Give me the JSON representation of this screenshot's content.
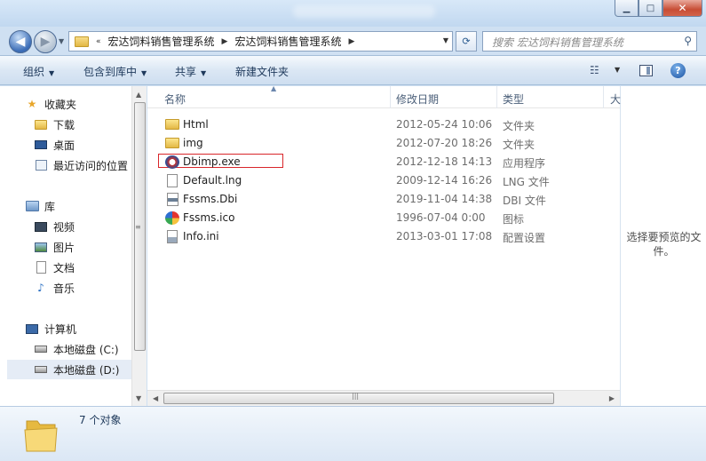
{
  "window": {
    "controls": {
      "minimize": "▁",
      "maximize": "□",
      "close": "✕"
    }
  },
  "address": {
    "overflow": "«",
    "segments": [
      "宏达饲料销售管理系统",
      "宏达饲料销售管理系统"
    ],
    "search_placeholder": "搜索 宏达饲料销售管理系统"
  },
  "toolbar": {
    "organize": "组织",
    "include_in_library": "包含到库中",
    "share": "共享",
    "new_folder": "新建文件夹"
  },
  "nav": {
    "favorites": "收藏夹",
    "downloads": "下载",
    "desktop": "桌面",
    "recent": "最近访问的位置",
    "libraries": "库",
    "videos": "视频",
    "pictures": "图片",
    "documents": "文档",
    "music": "音乐",
    "computer": "计算机",
    "drive_c": "本地磁盘 (C:)",
    "drive_d": "本地磁盘 (D:)"
  },
  "columns": {
    "name": "名称",
    "modified": "修改日期",
    "type": "类型",
    "size": "大"
  },
  "files": [
    {
      "name": "Html",
      "date": "2012-05-24 10:06",
      "type": "文件夹",
      "icon": "folder-icon"
    },
    {
      "name": "img",
      "date": "2012-07-20 18:26",
      "type": "文件夹",
      "icon": "folder-icon"
    },
    {
      "name": "Dbimp.exe",
      "date": "2012-12-18 14:13",
      "type": "应用程序",
      "icon": "app-icon"
    },
    {
      "name": "Default.lng",
      "date": "2009-12-14 16:26",
      "type": "LNG 文件",
      "icon": "file-icon"
    },
    {
      "name": "Fssms.Dbi",
      "date": "2019-11-04 14:38",
      "type": "DBI 文件",
      "icon": "dbi-icon"
    },
    {
      "name": "Fssms.ico",
      "date": "1996-07-04 0:00",
      "type": "图标",
      "icon": "ico-icon"
    },
    {
      "name": "Info.ini",
      "date": "2013-03-01 17:08",
      "type": "配置设置",
      "icon": "ini-icon"
    }
  ],
  "preview": {
    "text": "选择要预览的文件。"
  },
  "details": {
    "count": "7 个对象"
  },
  "colors": {
    "highlight_box": "#d9262a",
    "selection": "#e5ecf6"
  }
}
